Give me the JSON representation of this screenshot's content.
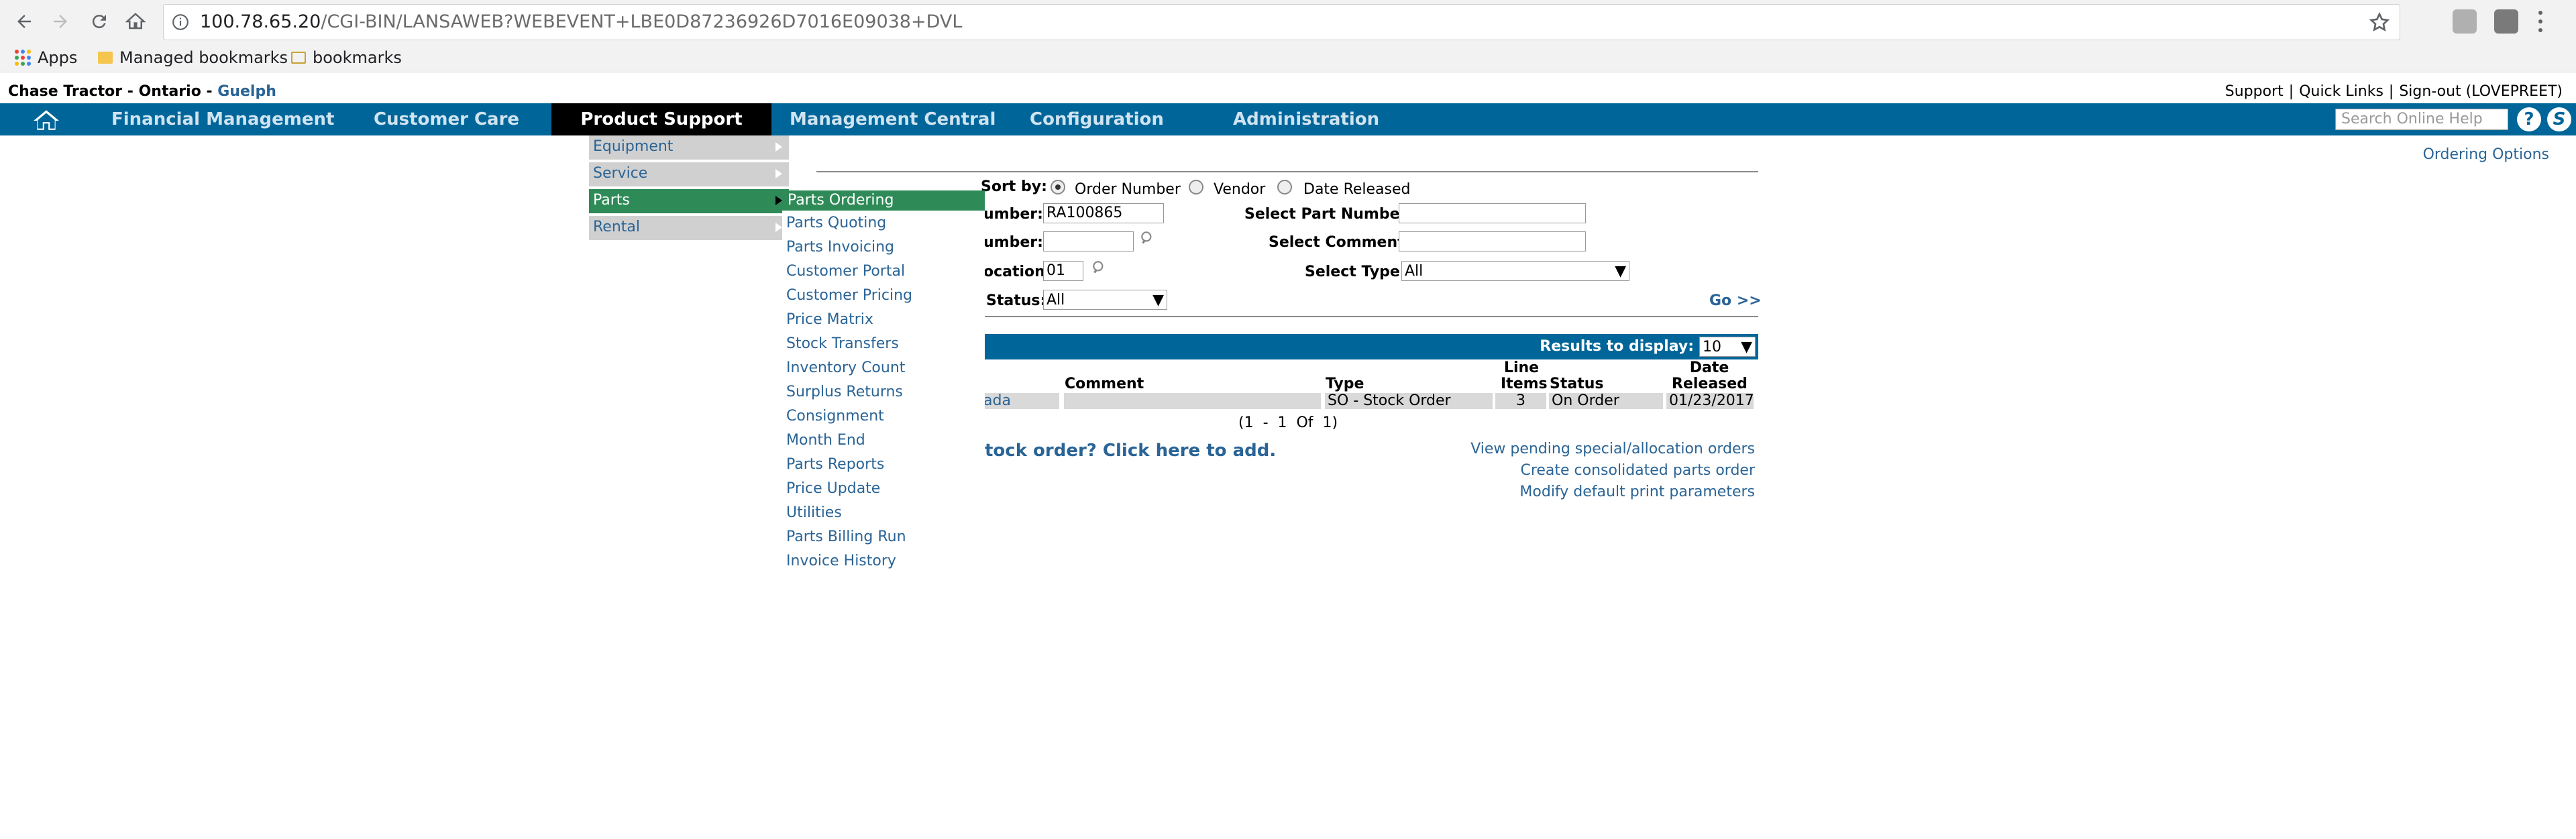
{
  "browser": {
    "url_host": "100.78.65.20",
    "url_path": "/CGI-BIN/LANSAWEB?WEBEVENT+LBE0D87236926D7016E09038+DVL",
    "bookmarks": [
      "Apps",
      "Managed bookmarks",
      "bookmarks"
    ]
  },
  "header": {
    "company": "Chase Tractor - Ontario - ",
    "city": "Guelph",
    "links": [
      "Support",
      "Quick Links",
      "Sign-out (LOVEPREET)"
    ],
    "link_sep": "|"
  },
  "nav": {
    "items": [
      "Financial Management",
      "Customer Care",
      "Product Support",
      "Management Central",
      "Configuration",
      "Administration"
    ],
    "active": "Product Support",
    "help_placeholder": "Search Online Help",
    "bar_color": "#006699"
  },
  "ordering_options": "Ordering Options",
  "form": {
    "sort_by_label": "Sort by:",
    "sort_options": [
      "Order Number",
      "Vendor",
      "Date Released"
    ],
    "order_number_label": "umber:",
    "order_number_value": "RA100865",
    "vendor_number_label": "umber:",
    "location_label": "ocation:",
    "location_value": "01",
    "status_label": "Status:",
    "status_value": "All",
    "part_number_label": "Select Part Number:",
    "comment_label": "Select Comment:",
    "type_label": "Select Type:",
    "type_value": "All",
    "go": "Go >>"
  },
  "results": {
    "label": "Results to display:",
    "value": "10",
    "columns": {
      "comment": "Comment",
      "type": "Type",
      "line_items_1": "Line",
      "line_items_2": "Items",
      "status": "Status",
      "date_1": "Date",
      "date_2": "Released"
    },
    "row": {
      "vendor": "ada",
      "comment": "",
      "type": "SO - Stock Order",
      "line_items": "3",
      "status": "On Order",
      "date": "01/23/2017"
    },
    "pagination": "(1  -  1  Of  1)",
    "add_prompt": "tock order? Click here to add.",
    "links": [
      "View pending special/allocation orders",
      "Create consolidated parts order",
      "Modify default print parameters"
    ]
  },
  "menu_level1": [
    "Equipment",
    "Service",
    "Parts",
    "Rental"
  ],
  "menu_level2": [
    "Parts Ordering",
    "Parts Quoting",
    "Parts Invoicing",
    "Customer Portal",
    "Customer Pricing",
    "Price Matrix",
    "Stock Transfers",
    "Inventory Count",
    "Surplus Returns",
    "Consignment",
    "Month End",
    "Parts Reports",
    "Price Update",
    "Utilities",
    "Parts Billing Run",
    "Invoice History"
  ]
}
